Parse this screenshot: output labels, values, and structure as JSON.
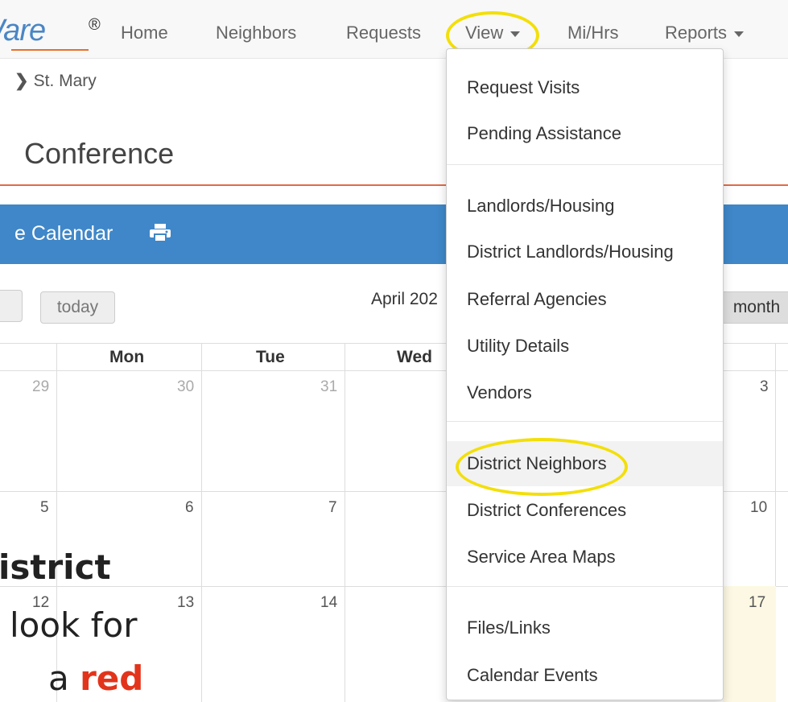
{
  "nav": {
    "logo": "Ware",
    "registered": "®",
    "home": "Home",
    "neighbors": "Neighbors",
    "requests": "Requests",
    "view": "View",
    "mihrs": "Mi/Hrs",
    "reports": "Reports"
  },
  "breadcrumb": {
    "item": "St. Mary"
  },
  "page": {
    "title": "Conference",
    "calendar_label": "e Calendar"
  },
  "toolbar": {
    "today": "today",
    "month_title": "April 202",
    "month_button": "month"
  },
  "calendar": {
    "days": [
      "Mon",
      "Tue",
      "Wed"
    ],
    "week1": [
      "29",
      "30",
      "31",
      "3"
    ],
    "week2": [
      "5",
      "6",
      "7",
      "10"
    ],
    "week3": [
      "12",
      "13",
      "14",
      "17"
    ]
  },
  "overlay": {
    "line1": "istrict",
    "line2": "look for",
    "line3_prefix": "a ",
    "line3_red": "red"
  },
  "view_menu": {
    "items": [
      "Request Visits",
      "Pending Assistance",
      "Landlords/Housing",
      "District Landlords/Housing",
      "Referral Agencies",
      "Utility Details",
      "Vendors",
      "District Neighbors",
      "District Conferences",
      "Service Area Maps",
      "Files/Links",
      "Calendar Events"
    ]
  },
  "colors": {
    "accent_blue": "#3f87c8",
    "highlight_yellow": "#f3df0a",
    "title_rule": "#e06b47",
    "overlay_red": "#e2341b"
  }
}
